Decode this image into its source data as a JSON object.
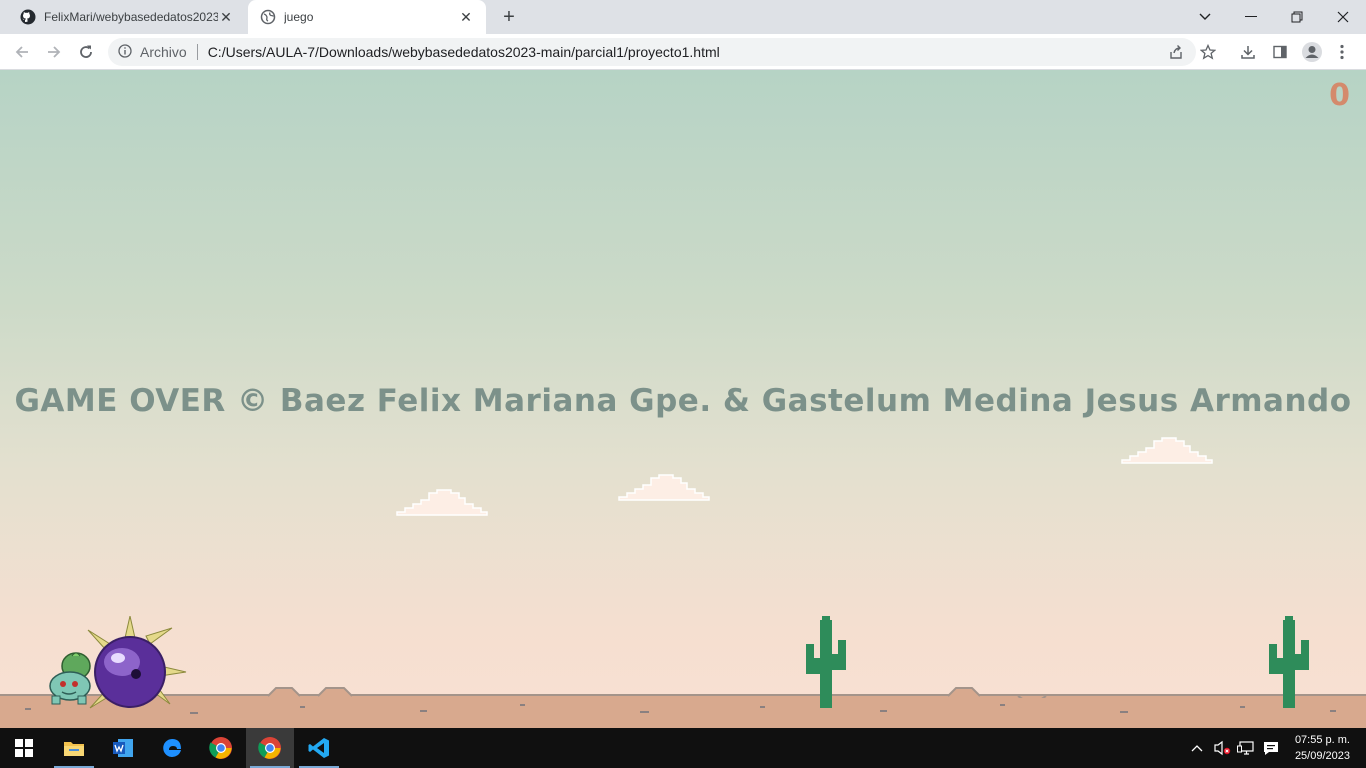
{
  "browser": {
    "tabs": [
      {
        "title": "FelixMari/webybasededatos2023",
        "icon": "github-icon"
      },
      {
        "title": "juego",
        "icon": "globe-icon"
      }
    ],
    "omnibox": {
      "origin_label": "Archivo",
      "url": "C:/Users/AULA-7/Downloads/webybasededatos2023-main/parcial1/proyecto1.html"
    }
  },
  "game": {
    "score": "0",
    "game_over_text": "GAME OVER © Baez Felix Mariana Gpe. & Gastelum Medina Jesus Armando",
    "colors": {
      "sky_top": "#b6d3c5",
      "sky_bottom": "#f9e0d3",
      "ground": "#d8a98e",
      "cactus": "#2e8c5a",
      "score": "#d48a6c",
      "text": "#7c918a"
    }
  },
  "taskbar": {
    "apps": [
      "windows-start",
      "file-explorer",
      "word",
      "edge",
      "chrome",
      "chrome-active",
      "vscode"
    ],
    "clock": {
      "time": "07:55 p. m.",
      "date": "25/09/2023"
    }
  }
}
